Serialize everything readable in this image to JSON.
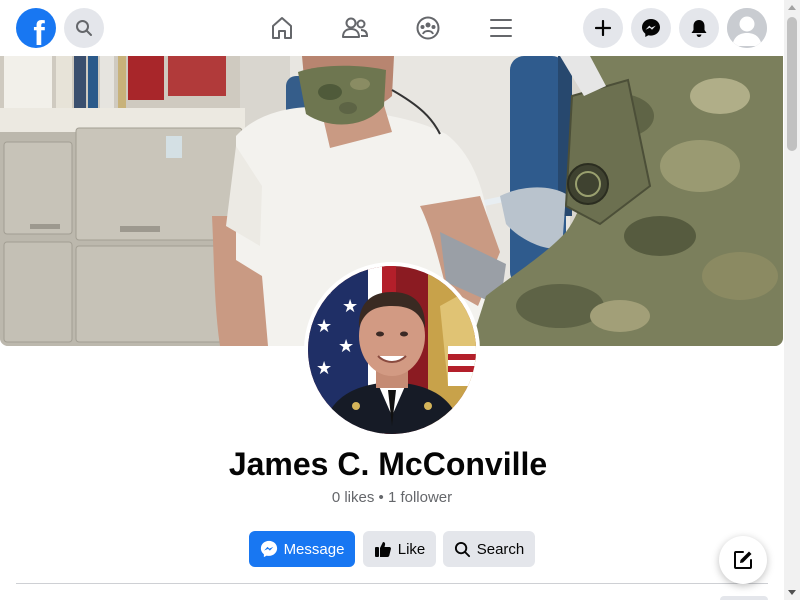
{
  "topbar": {
    "logo_letter": "f",
    "icons": {
      "logo": "facebook-logo",
      "search": "search-icon",
      "home": "home-icon",
      "friends": "friends-icon",
      "groups": "groups-icon",
      "menu": "menu-icon",
      "create": "plus-icon",
      "messenger": "messenger-icon",
      "notifications": "bell-icon",
      "account": "avatar-icon"
    }
  },
  "profile": {
    "name": "James C. McConville",
    "stats": "0 likes • 1 follower"
  },
  "actions": {
    "message_label": "Message",
    "like_label": "Like",
    "search_label": "Search"
  },
  "colors": {
    "brand": "#1877f2",
    "secondary_button": "#e4e6eb",
    "text_primary": "#050505",
    "text_secondary": "#65676b"
  }
}
